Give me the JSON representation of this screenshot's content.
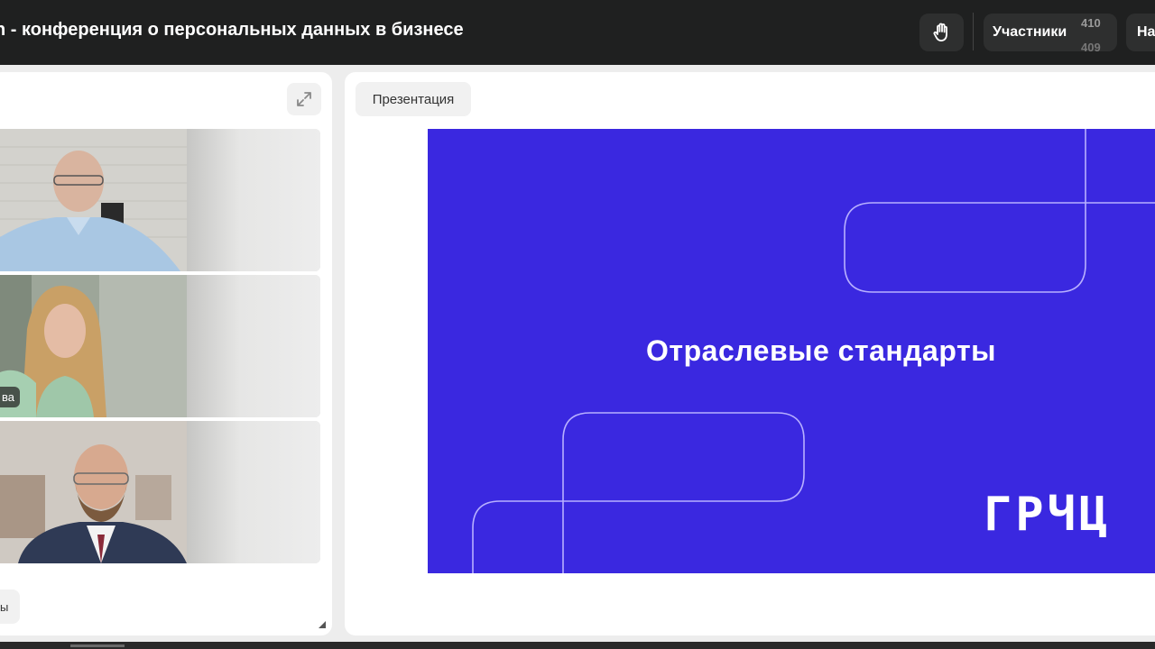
{
  "header": {
    "title": "n - конференция о персональных данных в бизнесе",
    "participants_label": "Участники",
    "participants_count": "410",
    "participants_count_second": "409",
    "settings_label_partial": "На"
  },
  "icons": {
    "raise_hand": "raise-hand-icon",
    "expand": "expand-icon",
    "resize": "resize-handle-icon"
  },
  "left_panel": {
    "tiles": [
      {
        "name_badge": ""
      },
      {
        "name_badge": "ва"
      },
      {
        "name_badge": ""
      }
    ],
    "bottom_chip_label": "ы"
  },
  "presentation": {
    "tab_label": "Презентация",
    "slide_title": "Отраслевые стандарты",
    "slide_logo": "ГРЧЦ",
    "slide_color": "#3a28e0"
  }
}
